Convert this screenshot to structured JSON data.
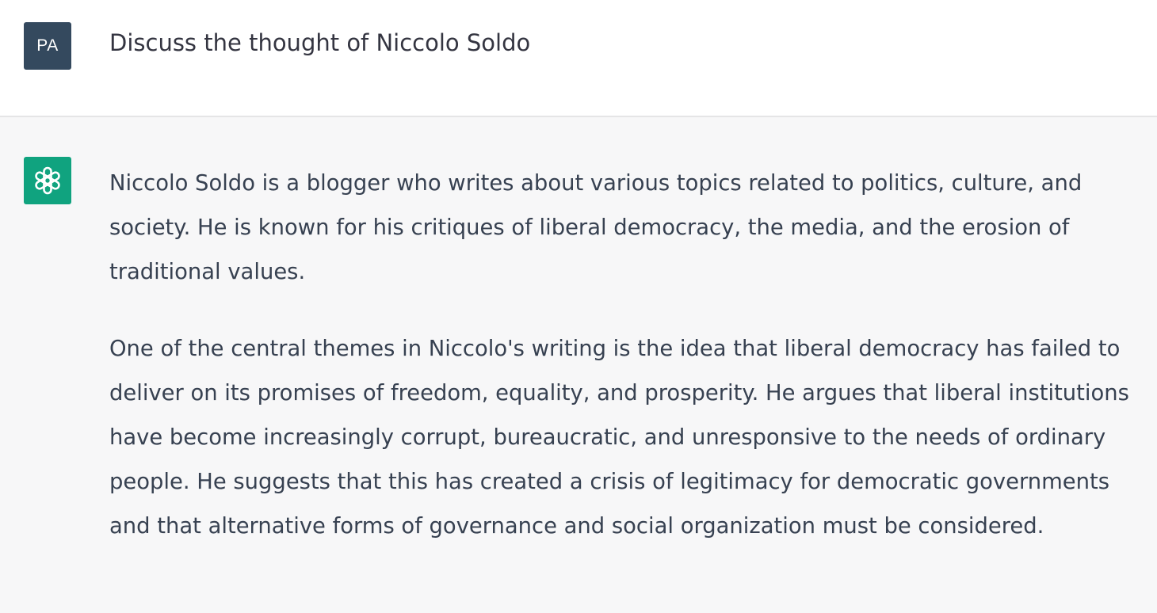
{
  "user_message": {
    "avatar_initials": "PA",
    "text": "Discuss the thought of Niccolo Soldo"
  },
  "assistant_message": {
    "avatar_icon": "openai-logo-icon",
    "paragraphs": [
      "Niccolo Soldo is a blogger who writes about various topics related to politics, culture, and society. He is known for his critiques of liberal democracy, the media, and the erosion of traditional values.",
      "One of the central themes in Niccolo's writing is the idea that liberal democracy has failed to deliver on its promises of freedom, equality, and prosperity. He argues that liberal institutions have become increasingly corrupt, bureaucratic, and unresponsive to the needs of ordinary people. He suggests that this has created a crisis of legitimacy for democratic governments and that alternative forms of governance and social organization must be considered."
    ]
  },
  "colors": {
    "user_avatar_bg": "#34495e",
    "assistant_avatar_bg": "#10a37f",
    "assistant_row_bg": "#f7f7f8",
    "user_row_bg": "#ffffff",
    "text": "#374151"
  }
}
